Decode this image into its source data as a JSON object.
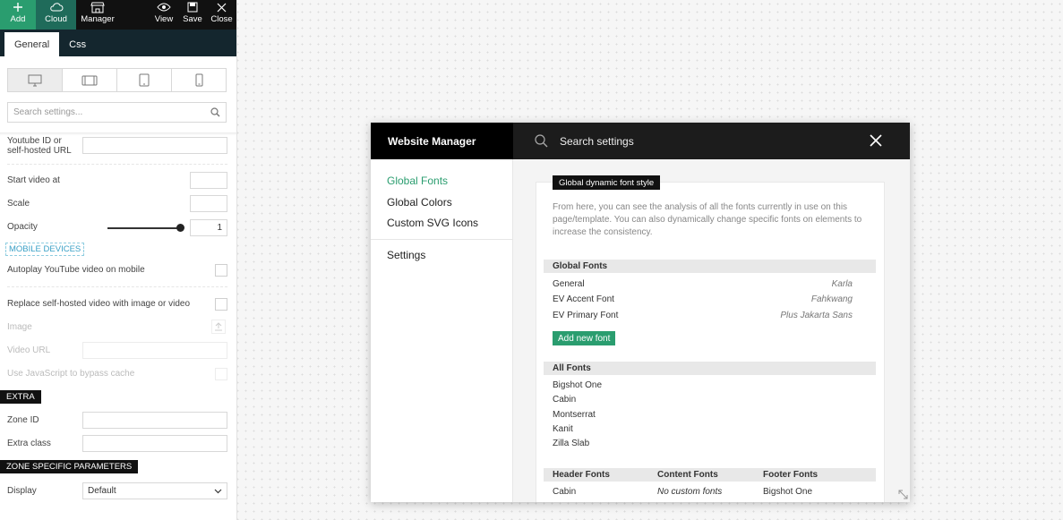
{
  "toolbar": {
    "add": "Add",
    "cloud": "Cloud",
    "manager": "Manager",
    "view": "View",
    "save": "Save",
    "close": "Close"
  },
  "tabs": [
    "General",
    "Css"
  ],
  "search": {
    "placeholder": "Search settings..."
  },
  "settings": {
    "youtube_label_1": "Youtube ID or",
    "youtube_label_2": "self-hosted URL",
    "start_video": "Start video at",
    "scale": "Scale",
    "opacity": "Opacity",
    "opacity_value": "1",
    "opacity_level": 1,
    "mobile_devices": "MOBILE DEVICES",
    "autoplay_mobile": "Autoplay YouTube video on mobile",
    "replace_video": "Replace self-hosted video with image or video",
    "image": "Image",
    "video_url": "Video URL",
    "bypass_cache": "Use JavaScript to bypass cache",
    "extra": "EXTRA",
    "zone_id": "Zone ID",
    "extra_class": "Extra class",
    "zone_params": "ZONE SPECIFIC PARAMETERS",
    "display": "Display",
    "display_value": "Default"
  },
  "modal": {
    "title": "Website Manager",
    "search_text": "Search settings",
    "nav": [
      "Global Fonts",
      "Global Colors",
      "Custom SVG Icons",
      "Settings"
    ],
    "badge": "Global dynamic font style",
    "description": "From here, you can see the analysis of all the fonts currently in use on this page/template. You can also dynamically change specific fonts on elements to increase the consistency.",
    "global_fonts_head": "Global Fonts",
    "global_fonts": [
      {
        "label": "General",
        "font": "Karla"
      },
      {
        "label": "EV Accent Font",
        "font": "Fahkwang"
      },
      {
        "label": "EV Primary Font",
        "font": "Plus Jakarta Sans"
      }
    ],
    "add_font": "Add new font",
    "all_fonts_head": "All Fonts",
    "all_fonts": [
      "Bigshot One",
      "Cabin",
      "Montserrat",
      "Kanit",
      "Zilla Slab"
    ],
    "columns": [
      "Header Fonts",
      "Content Fonts",
      "Footer Fonts"
    ],
    "column_values": [
      "Cabin",
      "No custom fonts",
      "Bigshot One"
    ]
  },
  "colors": {
    "accent": "#2a9d6f",
    "dark": "#111111",
    "tab_bar": "#14262e"
  }
}
